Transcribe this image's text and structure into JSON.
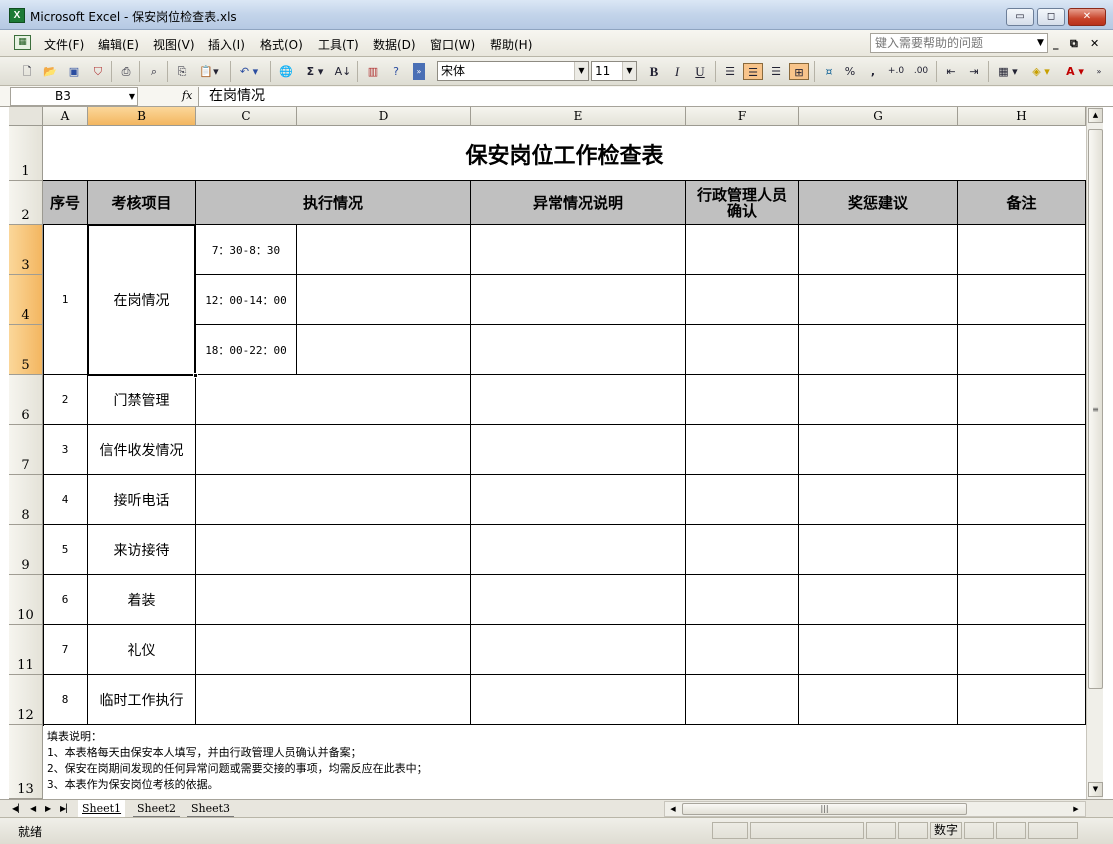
{
  "window": {
    "title": "Microsoft Excel - 保安岗位检查表.xls",
    "app_icon": "excel-icon",
    "controls": {
      "minimize": "▭",
      "maximize": "◻",
      "close": "✕"
    }
  },
  "menu": {
    "items": [
      "文件(F)",
      "编辑(E)",
      "视图(V)",
      "插入(I)",
      "格式(O)",
      "工具(T)",
      "数据(D)",
      "窗口(W)",
      "帮助(H)"
    ],
    "help_placeholder": "键入需要帮助的问题"
  },
  "toolbar": {
    "font_name": "宋体",
    "font_size": "11",
    "bold": "B",
    "italic": "I",
    "underline": "U",
    "sigma": "Σ",
    "percent": "%",
    "comma": ","
  },
  "formula_bar": {
    "name_box": "B3",
    "fx": "fx",
    "content": "在岗情况"
  },
  "columns": [
    "A",
    "B",
    "C",
    "D",
    "E",
    "F",
    "G",
    "H"
  ],
  "selected_column": "B",
  "rows": [
    "1",
    "2",
    "3",
    "4",
    "5",
    "6",
    "7",
    "8",
    "9",
    "10",
    "11",
    "12",
    "13"
  ],
  "selected_rows": [
    "3",
    "4",
    "5"
  ],
  "sheet": {
    "title": "保安岗位工作检查表",
    "headers": {
      "seq": "序号",
      "item": "考核项目",
      "exec": "执行情况",
      "abnormal": "异常情况说明",
      "admin": "行政管理人员确认",
      "reward": "奖惩建议",
      "remark": "备注"
    },
    "item1": {
      "seq": "1",
      "name": "在岗情况",
      "times": [
        "7：30-8：30",
        "12：00-14：00",
        "18：00-22：00"
      ]
    },
    "items": [
      {
        "seq": "2",
        "name": "门禁管理"
      },
      {
        "seq": "3",
        "name": "信件收发情况"
      },
      {
        "seq": "4",
        "name": "接听电话"
      },
      {
        "seq": "5",
        "name": "来访接待"
      },
      {
        "seq": "6",
        "name": "着装"
      },
      {
        "seq": "7",
        "name": "礼仪"
      },
      {
        "seq": "8",
        "name": "临时工作执行"
      }
    ],
    "notes": [
      "填表说明：",
      "1、本表格每天由保安本人填写，并由行政管理人员确认并备案；",
      "2、保安在岗期间发现的任何异常问题或需要交接的事项，均需反应在此表中；",
      "3、本表作为保安岗位考核的依据。"
    ]
  },
  "tabs": [
    "Sheet1",
    "Sheet2",
    "Sheet3"
  ],
  "active_tab": "Sheet1",
  "status": {
    "ready": "就绪",
    "mode": "数字"
  }
}
